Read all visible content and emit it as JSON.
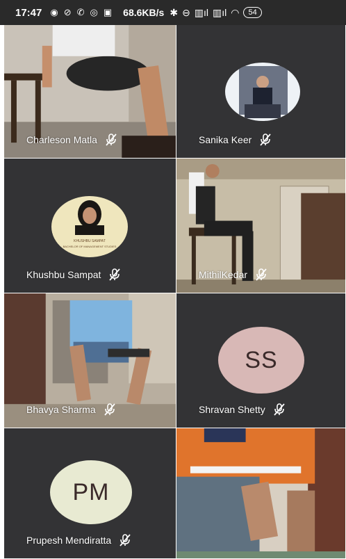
{
  "status_bar": {
    "time": "17:47",
    "net_speed": "68.6KB/s",
    "battery": "54",
    "icons": [
      "vpn-icon",
      "blocked-icon",
      "phone-icon",
      "whatsapp-icon",
      "app-icon",
      "bluetooth-icon",
      "battery-saver-icon",
      "signal-icon",
      "signal-icon",
      "wifi-icon",
      "battery-icon"
    ]
  },
  "participants": [
    {
      "name": "Charleson Matla",
      "muted": true,
      "video": true
    },
    {
      "name": "Sanika Keer",
      "muted": true,
      "video": false,
      "avatar": "photo"
    },
    {
      "name": "Khushbu Sampat",
      "muted": true,
      "video": false,
      "avatar": "photo",
      "photo_text": [
        "KHUSHBU SAMPAT",
        "BACHELOR OF MANAGEMENT STUDIES"
      ]
    },
    {
      "name": "MithilKedar",
      "muted": true,
      "video": true
    },
    {
      "name": "Bhavya Sharma",
      "muted": true,
      "video": true
    },
    {
      "name": "Shravan Shetty",
      "muted": true,
      "video": false,
      "initials": "SS",
      "avatar_color": "#d8b8b6"
    },
    {
      "name": "Prupesh Mendiratta",
      "muted": true,
      "video": false,
      "initials": "PM",
      "avatar_color": "#e8ead2"
    },
    {
      "name": "",
      "muted": false,
      "video": true
    }
  ]
}
